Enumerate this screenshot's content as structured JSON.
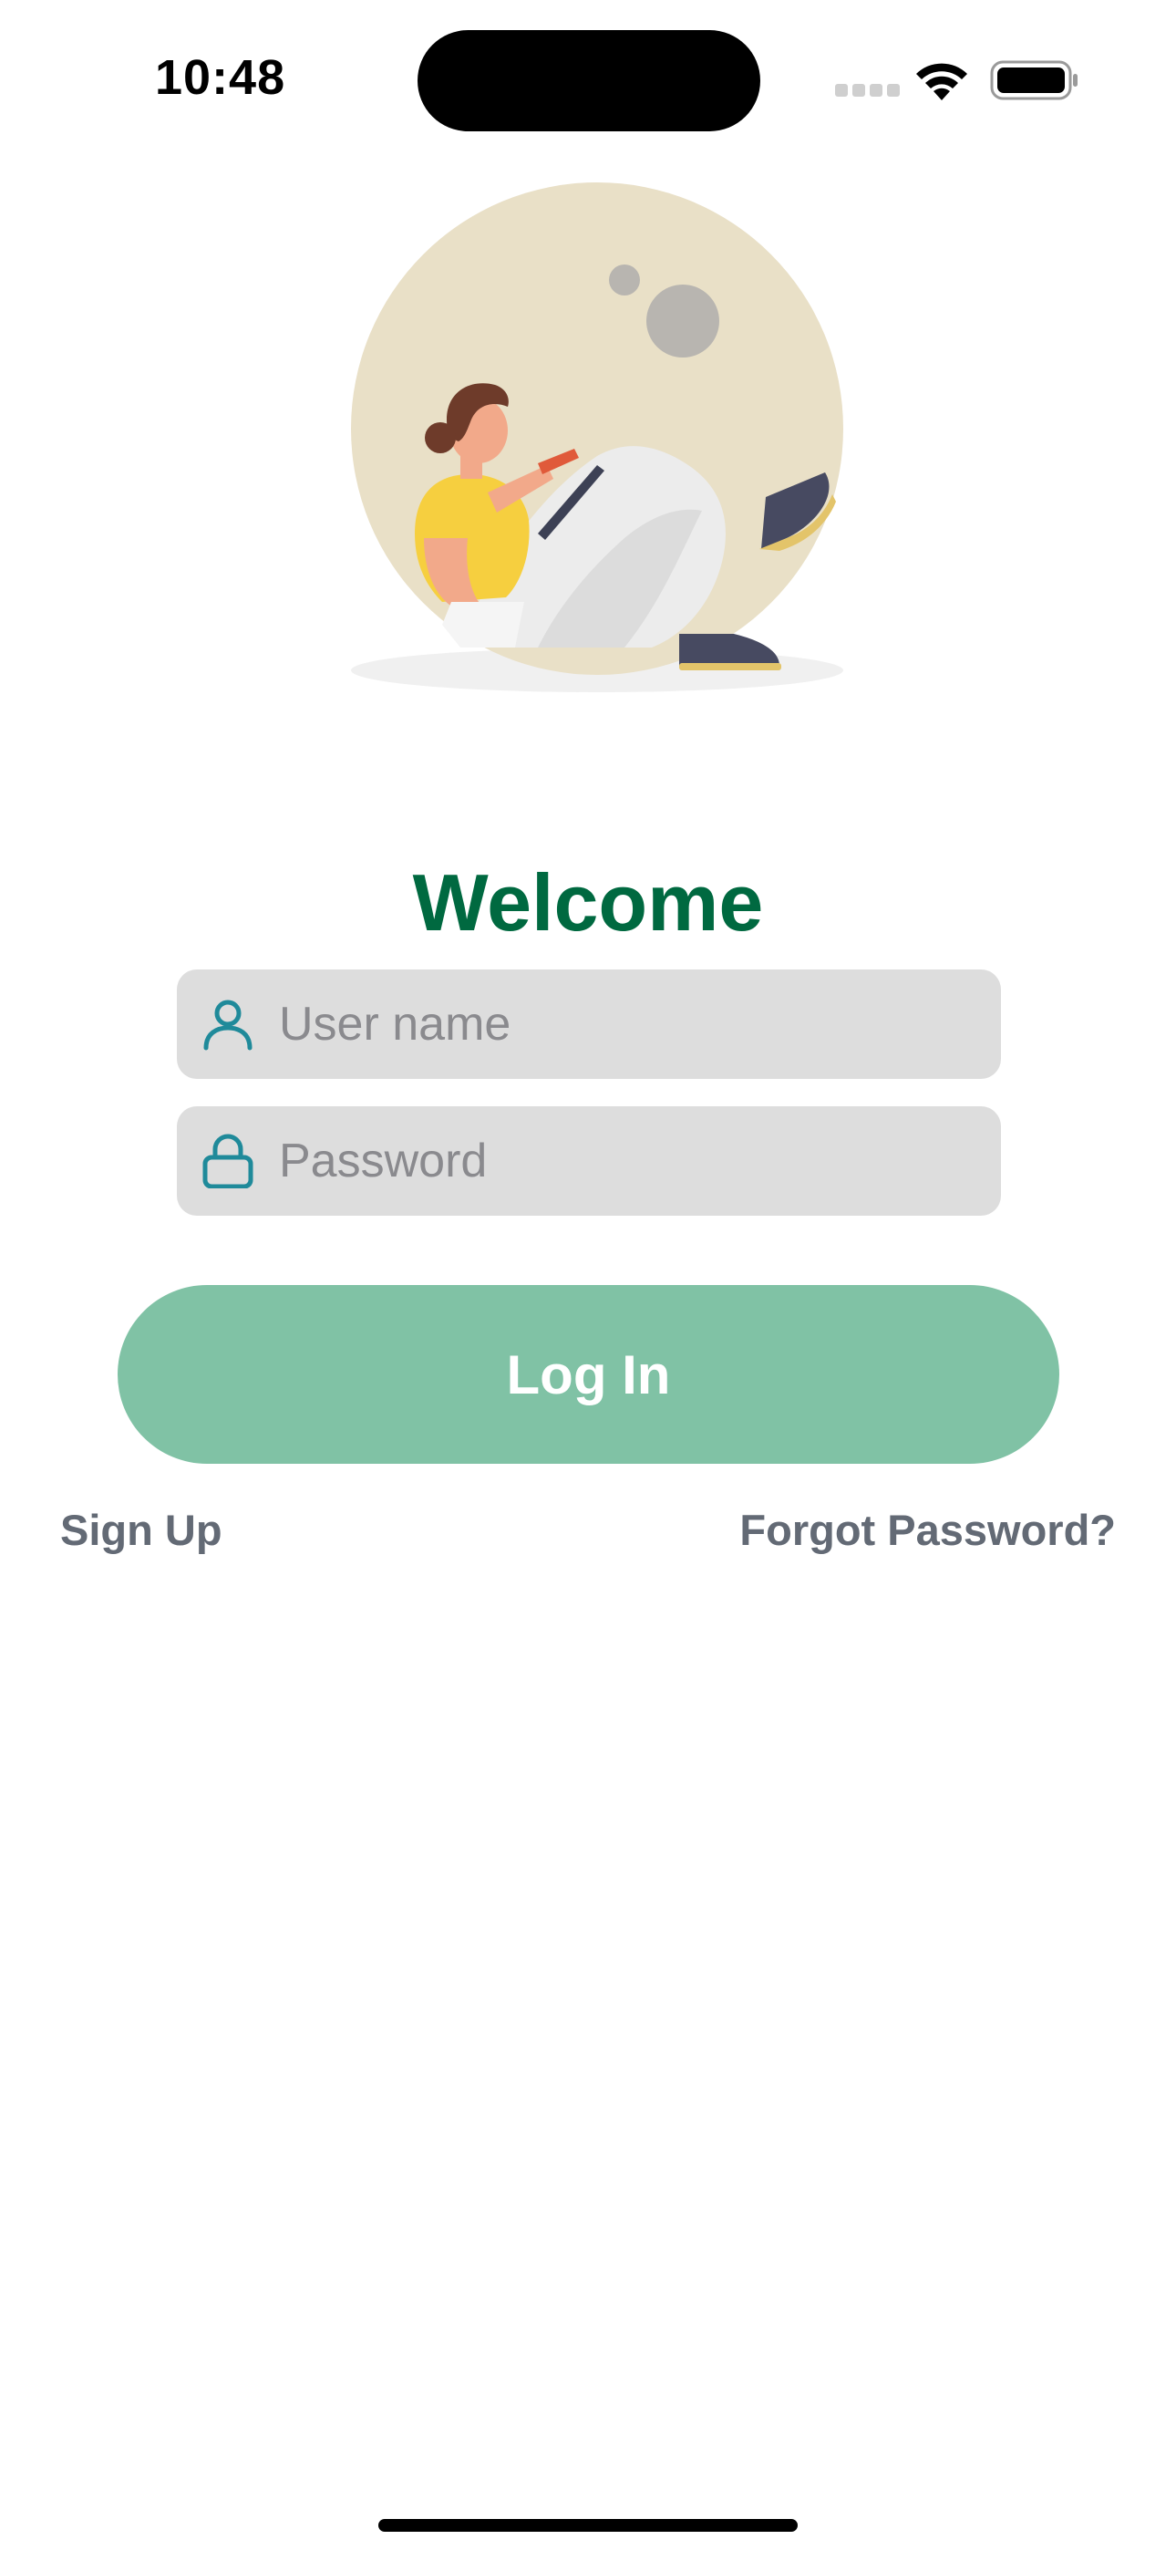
{
  "status_bar": {
    "time": "10:48"
  },
  "welcome": {
    "title": "Welcome"
  },
  "form": {
    "username": {
      "placeholder": "User name",
      "value": "",
      "icon": "person-icon"
    },
    "password": {
      "placeholder": "Password",
      "value": "",
      "icon": "lock-icon"
    },
    "login_label": "Log In"
  },
  "links": {
    "sign_up": "Sign Up",
    "forgot_password": "Forgot Password?"
  },
  "colors": {
    "title": "#006940",
    "accent_icon": "#1f8a9a",
    "button": "#80c2a5",
    "field_bg": "#dddddd",
    "link": "#636a75"
  }
}
